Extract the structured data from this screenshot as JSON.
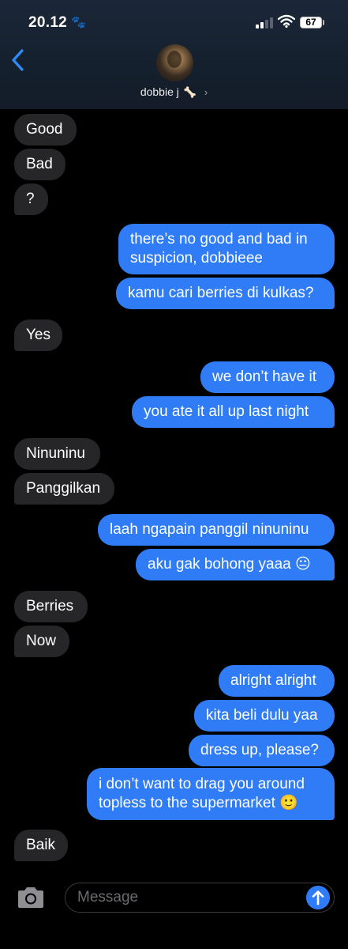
{
  "status_bar": {
    "time": "20.12",
    "battery": "67"
  },
  "header": {
    "contact_name": "dobbie j",
    "name_emoji": "🦴",
    "chevron": "›"
  },
  "messages": [
    {
      "dir": "in",
      "text": "Good"
    },
    {
      "dir": "in",
      "text": "Bad"
    },
    {
      "dir": "in",
      "text": "?"
    },
    {
      "dir": "out",
      "text": "there’s no good and bad in suspicion, dobbieee"
    },
    {
      "dir": "out",
      "text": "kamu cari berries di kulkas?"
    },
    {
      "dir": "in",
      "text": "Yes"
    },
    {
      "dir": "out",
      "text": "we don’t have it"
    },
    {
      "dir": "out",
      "text": "you ate it all up last night"
    },
    {
      "dir": "in",
      "text": "Ninuninu"
    },
    {
      "dir": "in",
      "text": "Panggilkan"
    },
    {
      "dir": "out",
      "text": "laah ngapain panggil ninuninu"
    },
    {
      "dir": "out",
      "text": "aku gak bohong yaaa 😐"
    },
    {
      "dir": "in",
      "text": "Berries"
    },
    {
      "dir": "in",
      "text": "Now"
    },
    {
      "dir": "out",
      "text": "alright alright"
    },
    {
      "dir": "out",
      "text": "kita beli dulu yaa"
    },
    {
      "dir": "out",
      "text": "dress up, please?"
    },
    {
      "dir": "out",
      "text": "i don’t want to drag you around topless to the supermarket 🙂"
    },
    {
      "dir": "in",
      "text": "Baik"
    }
  ],
  "composer": {
    "placeholder": "Message"
  },
  "colors": {
    "outgoing": "#2f7cf6",
    "incoming": "#262628",
    "accent": "#2f7cf6"
  },
  "icons": {
    "back": "chevron-left-icon",
    "camera": "camera-icon",
    "send": "arrow-up-icon",
    "paw": "paw-icon"
  }
}
